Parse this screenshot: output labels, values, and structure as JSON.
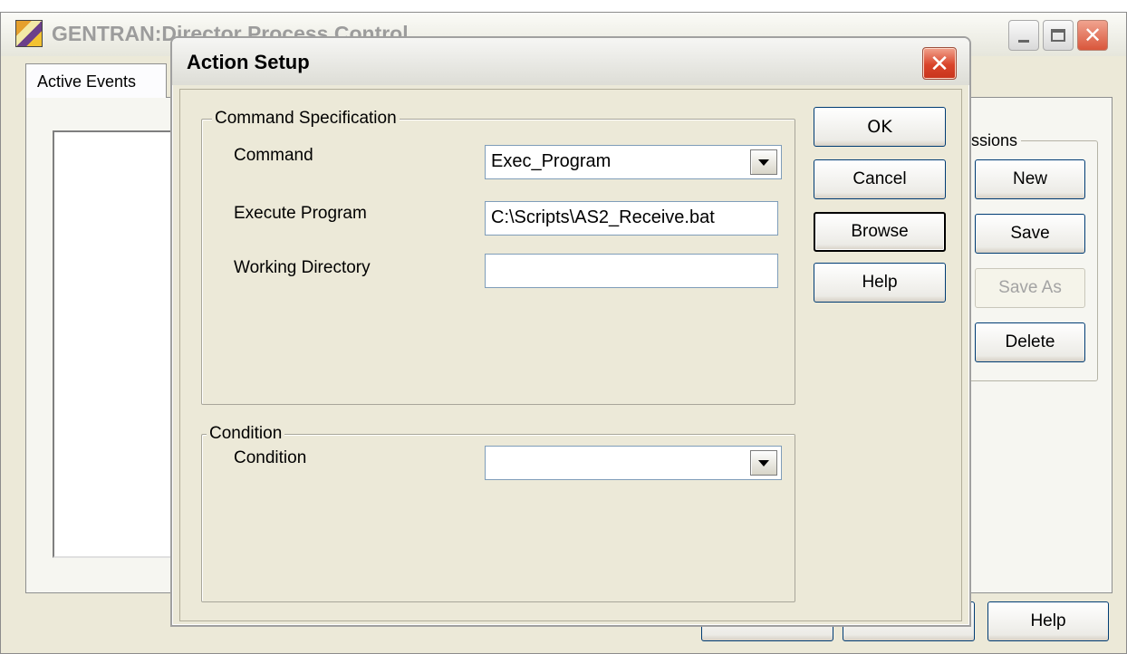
{
  "background_window": {
    "title": "GENTRAN:Director Process Control",
    "tab": "Active Events",
    "group_label": "ssions",
    "buttons": {
      "new": "New",
      "save": "Save",
      "save_as": "Save As",
      "delete": "Delete",
      "help": "Help"
    }
  },
  "dialog": {
    "title": "Action Setup",
    "close_glyph": "✕",
    "command_group": {
      "legend": "Command Specification",
      "command_label": "Command",
      "command_value": "Exec_Program",
      "execute_label": "Execute Program",
      "execute_value": "C:\\Scripts\\AS2_Receive.bat",
      "workdir_label": "Working Directory",
      "workdir_value": ""
    },
    "condition_group": {
      "legend": "Condition",
      "condition_label": "Condition",
      "condition_value": ""
    },
    "buttons": {
      "ok": "OK",
      "cancel": "Cancel",
      "browse": "Browse",
      "help": "Help"
    }
  }
}
